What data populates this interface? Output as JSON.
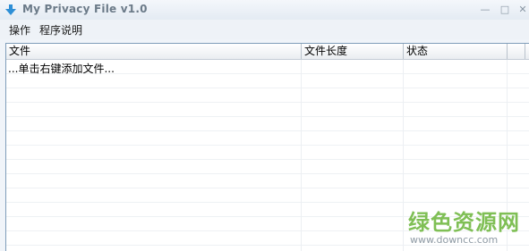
{
  "window": {
    "title": "My Privacy File v1.0",
    "controls": {
      "minimize": "—",
      "maximize": "□",
      "close": "✕"
    }
  },
  "menu": {
    "items": [
      {
        "label": "操作"
      },
      {
        "label": "程序说明"
      }
    ]
  },
  "list": {
    "columns": [
      "文件",
      "文件长度",
      "状态",
      ""
    ],
    "rows": [
      {
        "file": "...单击右键添加文件...",
        "size": "",
        "status": ""
      }
    ]
  },
  "watermark": {
    "main": "绿色资源网",
    "url": "www.downcc.com"
  },
  "colors": {
    "accent_icon": "#2e8fd6",
    "watermark_green": "#7fbf55"
  }
}
